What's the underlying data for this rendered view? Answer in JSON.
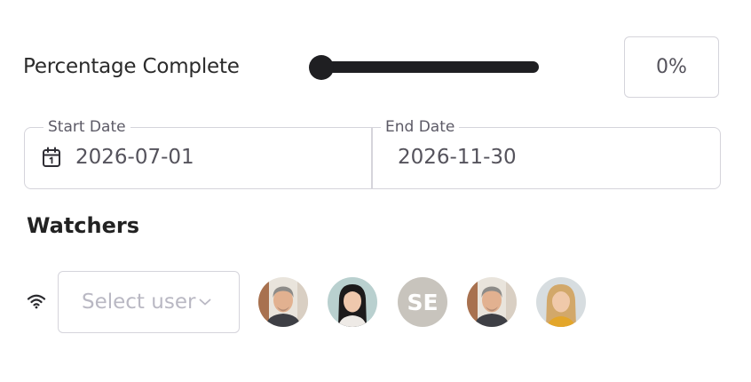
{
  "progress": {
    "label": "Percentage Complete",
    "value_text": "0%",
    "value": 0
  },
  "dates": {
    "start_label": "Start Date",
    "start_value": "2026-07-01",
    "end_label": "End Date",
    "end_value": "2026-11-30"
  },
  "watchers": {
    "heading": "Watchers",
    "select_placeholder": "Select user",
    "avatars": [
      {
        "type": "photo",
        "icon": "man-gray-hair-avatar"
      },
      {
        "type": "photo",
        "icon": "woman-dark-hair-avatar"
      },
      {
        "type": "initials",
        "initials": "SE"
      },
      {
        "type": "photo",
        "icon": "man-gray-hair-avatar"
      },
      {
        "type": "photo",
        "icon": "woman-blonde-hair-avatar"
      }
    ]
  },
  "colors": {
    "slider": "#1f1f22",
    "border": "#d5d4db",
    "placeholder": "#b9b8c3",
    "initials_bg": "#c8c4bd"
  }
}
